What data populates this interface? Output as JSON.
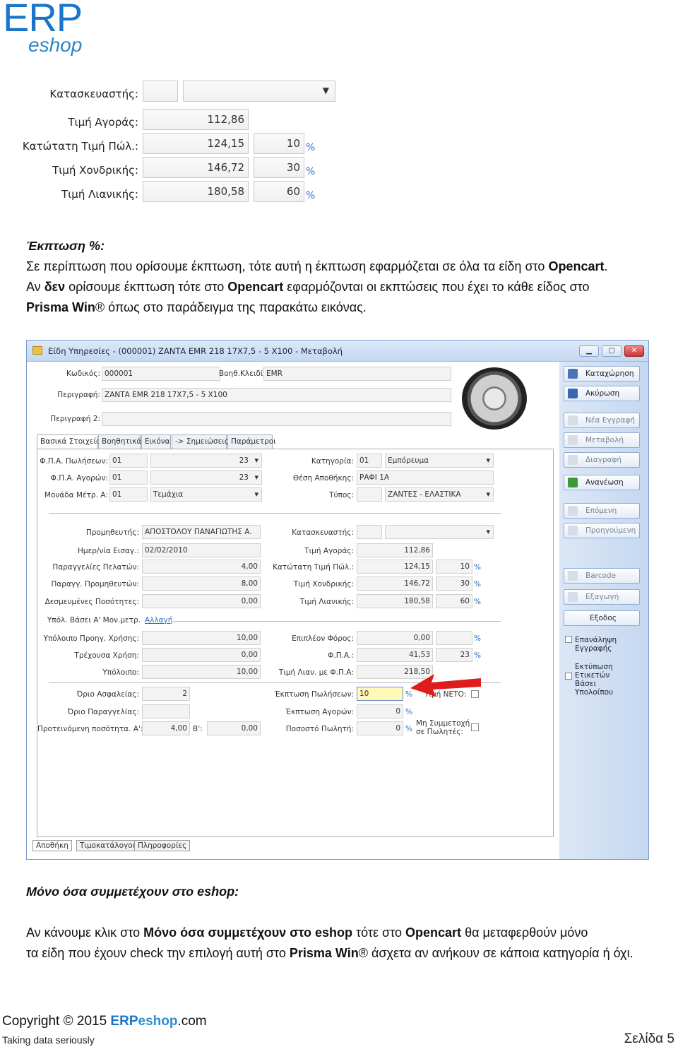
{
  "logo": {
    "erp": "ERP",
    "eshop": "eshop"
  },
  "snippet": {
    "rows": [
      {
        "label": "Κατασκευαστής:",
        "value": "",
        "pct": ""
      },
      {
        "label": "Τιμή Αγοράς:",
        "value": "112,86",
        "pct": ""
      },
      {
        "label": "Κατώτατη Τιμή Πώλ.:",
        "value": "124,15",
        "pct": "10"
      },
      {
        "label": "Τιμή Χονδρικής:",
        "value": "146,72",
        "pct": "30"
      },
      {
        "label": "Τιμή Λιανικής:",
        "value": "180,58",
        "pct": "60"
      }
    ],
    "pct_sign": "%"
  },
  "section1": {
    "heading": "Έκπτωση %:",
    "line1_a": "Σε περίπτωση που ορίσουμε έκπτωση, τότε αυτή η έκπτωση εφαρμόζεται σε όλα τα είδη στο ",
    "line1_b": "Opencart",
    "line1_c": ".",
    "line2_a": "Αν ",
    "line2_b": "δεν",
    "line2_c": " ορίσουμε έκπτωση τότε στο ",
    "line2_d": "Opencart",
    "line2_e": " εφαρμόζονται οι εκπτώσεις που έχει το κάθε είδος στο",
    "line3_a": "Prisma Win",
    "line3_b": "® όπως στο παράδειγμα της παρακάτω εικόνας."
  },
  "window": {
    "title": "Είδη Υπηρεσίες - (000001) ΖΑΝΤΑ EMR 218 17X7,5 - 5 X100 - Μεταβολή",
    "controls": [
      "▁",
      "▢",
      "✕"
    ],
    "kodikos_label": "Κωδικός:",
    "kodikos": "000001",
    "voith_label": "Βοηθ.Κλειδί:",
    "voith": "EMR",
    "perigrafi_label": "Περιγραφή:",
    "perigrafi": "ΖΑΝΤΑ EMR 218 17X7,5 - 5 X100",
    "perigrafi2_label": "Περιγραφή 2:",
    "perigrafi2": "",
    "tabs": [
      "Βασικά Στοιχεία",
      "Βοηθητικά",
      "Εικόνα",
      "-> Σημειώσεις",
      "Παράμετροι"
    ],
    "left_top": [
      {
        "label": "Φ.Π.Α. Πωλήσεων:",
        "code": "01",
        "value": "23"
      },
      {
        "label": "Φ.Π.Α. Αγορών:",
        "code": "01",
        "value": "23"
      },
      {
        "label": "Μονάδα Μέτρ. Α:",
        "code": "01",
        "value": "Τεμάχια"
      }
    ],
    "right_top": [
      {
        "label": "Κατηγορία:",
        "code": "01",
        "value": "Εμπόρευμα"
      },
      {
        "label": "Θέση Αποθήκης:",
        "code": "ΡΑΦΙ 1Α",
        "value": ""
      },
      {
        "label": "Τύπος:",
        "code": "",
        "value": "ΖΑΝΤΕΣ - ΕΛΑΣΤΙΚΑ"
      }
    ],
    "left_mid": [
      {
        "label": "Προμηθευτής:",
        "value": "ΑΠΟΣΤΟΛΟΥ ΠΑΝΑΓΙΩΤΗΣ Α."
      },
      {
        "label": "Ημερ/νία Εισαγ.:",
        "value": "02/02/2010"
      },
      {
        "label": "Παραγγελίες Πελατών:",
        "value": "4,00"
      },
      {
        "label": "Παραγγ. Προμηθευτών:",
        "value": "8,00"
      },
      {
        "label": "Δεσμευμένες Ποσότητες:",
        "value": "0,00"
      }
    ],
    "right_mid": [
      {
        "label": "Κατασκευαστής:",
        "value": "",
        "pct": ""
      },
      {
        "label": "Τιμή Αγοράς:",
        "value": "112,86",
        "pct": ""
      },
      {
        "label": "Κατώτατη Τιμή Πώλ.:",
        "value": "124,15",
        "pct": "10"
      },
      {
        "label": "Τιμή Χονδρικής:",
        "value": "146,72",
        "pct": "30"
      },
      {
        "label": "Τιμή Λιανικής:",
        "value": "180,58",
        "pct": "60"
      }
    ],
    "ypol_label": "Υπόλ. Βάσει Α' Μον.μετρ.",
    "ypol_link": "Αλλαγή",
    "left_low": [
      {
        "label": "Υπόλοιπο Προηγ. Χρήσης:",
        "value": "10,00"
      },
      {
        "label": "Τρέχουσα Χρήση:",
        "value": "0,00"
      },
      {
        "label": "Υπόλοιπο:",
        "value": "10,00"
      }
    ],
    "right_low": [
      {
        "label": "Επιπλέον Φόρος:",
        "value": "0,00",
        "pct": ""
      },
      {
        "label": "Φ.Π.Α.:",
        "value": "41,53",
        "pct": "23"
      },
      {
        "label": "Τιμή Λιαν. με Φ.Π.Α:",
        "value": "218,50",
        "pct": ""
      }
    ],
    "orio_asf_label": "Όριο Ασφαλείας:",
    "orio_asf": "2",
    "orio_par_label": "Όριο Παραγγελίας:",
    "orio_par": "",
    "proteinomeni_label": "Προτεινόμενη ποσότητα. Α':",
    "proteinomeni_a": "4,00",
    "proteinomeni_b_label": "Β':",
    "proteinomeni_b": "0,00",
    "ekptosi_pol_label": "Έκπτωση Πωλήσεων:",
    "ekptosi_pol": "10",
    "ekptosi_ag_label": "Έκπτωση Αγορών:",
    "ekptosi_ag": "0",
    "pososto_label": "Ποσοστό Πωλητή:",
    "pososto": "0",
    "timi_neto_label": "Τιμή ΝΕΤΟ:",
    "mi_symmet_label1": "Μη Συμμετοχή",
    "mi_symmet_label2": "σε Πωλητές:",
    "sidebar": {
      "buttons": [
        "Καταχώρηση",
        "Ακύρωση",
        "Νέα Εγγραφή",
        "Μεταβολή",
        "Διαγραφή",
        "Ανανέωση",
        "Επόμενη",
        "Προηγούμενη",
        "Barcode",
        "Εξαγωγή",
        "Εξοδος"
      ],
      "chk1_a": "Επανάληψη",
      "chk1_b": "Εγγραφής",
      "chk2_a": "Εκτύπωση",
      "chk2_b": "Ετικετών",
      "chk2_c": "Βάσει",
      "chk2_d": "Υπολοίπου"
    },
    "bottom_tabs": [
      "Αποθήκη",
      "Τιμοκατάλογοι",
      "Πληροφορίες"
    ]
  },
  "section2": {
    "heading": "Μόνο όσα συμμετέχουν στο eshop:",
    "line1_a": "Αν κάνουμε κλικ στο ",
    "line1_b": "Μόνο όσα συμμετέχουν στο eshop",
    "line1_c": " τότε στο ",
    "line1_d": "Opencart",
    "line1_e": " θα μεταφερθούν μόνο",
    "line2_a": "τα είδη που έχουν check την επιλογή αυτή στο ",
    "line2_b": "Prisma Win",
    "line2_c": "® άσχετα αν ανήκουν σε κάποια κατηγορία ή όχι."
  },
  "footer": {
    "copyright": "Copyright © 2015 ",
    "erp": "ERP",
    "eshop": "eshop",
    "com": ".com",
    "tagline": "Taking data seriously",
    "page": "Σελίδα 5"
  },
  "colors": {
    "brand_blue": "#1a74c9",
    "accent_red": "#e01b1b",
    "sidebar_blue": "#c5d8f0"
  }
}
